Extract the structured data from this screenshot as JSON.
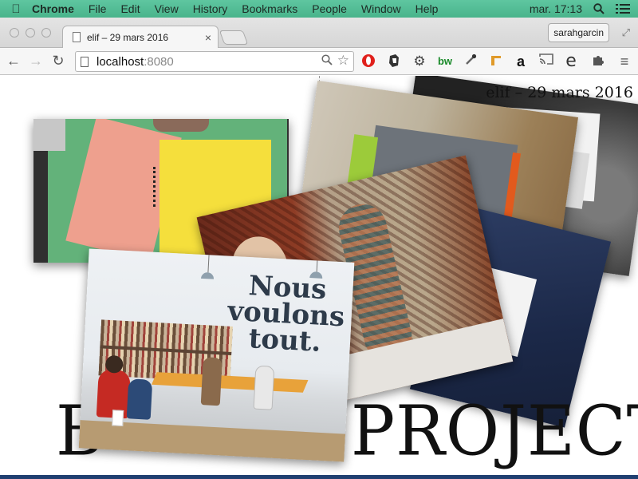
{
  "menubar": {
    "app": "Chrome",
    "items": [
      "File",
      "Edit",
      "View",
      "History",
      "Bookmarks",
      "People",
      "Window",
      "Help"
    ],
    "clock": "mar. 17:13"
  },
  "browser": {
    "tab_title": "elif – 29 mars 2016",
    "profile": "sarahgarcin",
    "url_host": "localhost",
    "url_port": ":8080"
  },
  "page": {
    "heading": "elif – 29 mars 2016",
    "title_left": "B",
    "title_right": "PROJECTS",
    "sign_text": [
      "Nous",
      "voulons",
      "tout."
    ]
  },
  "colors": {
    "menubar": "#4fba92",
    "accent_bar": "#1f3f70"
  }
}
